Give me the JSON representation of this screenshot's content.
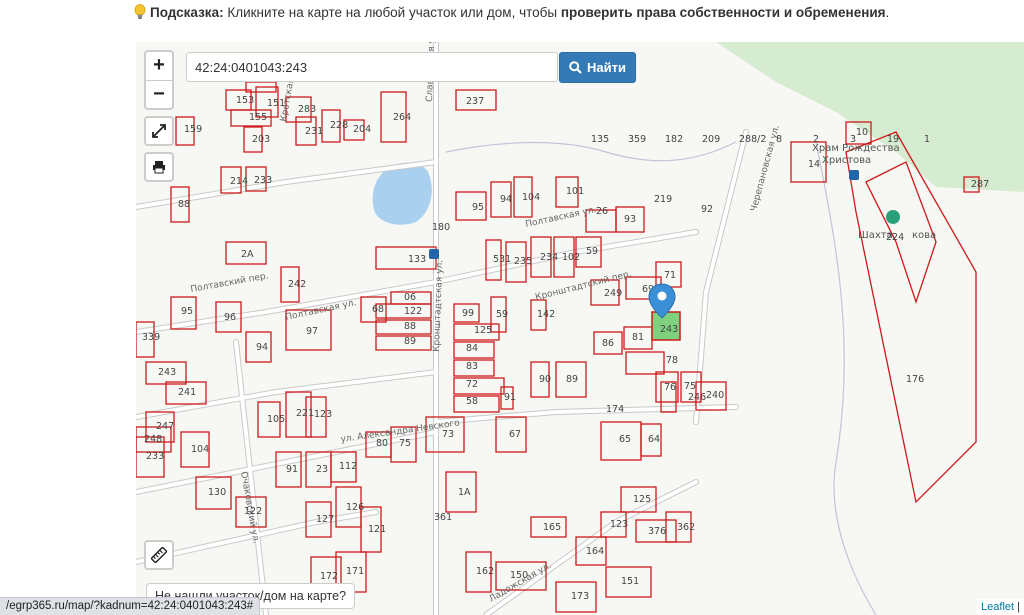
{
  "hint": {
    "label": "Подсказка:",
    "text": " Кликните на карте на любой участок или дом, чтобы ",
    "bold": "проверить права собственности и обременения",
    "end": "."
  },
  "map": {
    "zoom_in": "+",
    "zoom_out": "−",
    "search": {
      "value": "42:24:0401043:243"
    },
    "find_button": "Найти",
    "not_found": "Не нашли участок/дом на карте?",
    "attribution": "Leaflet",
    "attribution_sep": " |",
    "colors": {
      "parcel": "#cc1a1a",
      "selected": "#7fd17f",
      "pin": "#3a8fd6",
      "button": "#337ab7",
      "forest": "#d6ecd0",
      "water": "#a9d0ef"
    },
    "streets": [
      "Полтавский пер.",
      "Полтавская ул.",
      "Полтавская ул.",
      "Кронштадтский пер.",
      "Кронштадтская ул.",
      "ул. Александра Невского",
      "Очаковский ул.",
      "Черепановская ул.",
      "Ладожская ул.",
      "Славянская ул.",
      "Кротская ул."
    ],
    "pois": [
      "Храм Рождества",
      "Христова",
      "Шахта",
      "кова"
    ],
    "parcels": [
      "153",
      "151",
      "155",
      "203",
      "283",
      "231",
      "228",
      "204",
      "264",
      "237",
      "159",
      "10",
      "14",
      "287",
      "224",
      "214",
      "233",
      "88",
      "95",
      "94",
      "104",
      "101",
      "26",
      "92",
      "93",
      "2А",
      "133",
      "531",
      "235",
      "234",
      "102",
      "59",
      "71",
      "69",
      "249",
      "242",
      "68",
      "06",
      "122",
      "88",
      "89",
      "96",
      "95",
      "94",
      "97",
      "339",
      "99",
      "125",
      "59",
      "142",
      "84",
      "83",
      "72",
      "58",
      "91",
      "90",
      "89",
      "86",
      "81",
      "78",
      "76",
      "75",
      "246",
      "240",
      "243",
      "241",
      "247",
      "248",
      "80",
      "233",
      "104",
      "105",
      "221",
      "123",
      "75",
      "73",
      "67",
      "65",
      "64",
      "91",
      "23",
      "112",
      "130",
      "122",
      "1А",
      "127",
      "126",
      "121",
      "125",
      "123",
      "376",
      "362",
      "165",
      "164",
      "162",
      "150",
      "151",
      "173",
      "171",
      "172",
      "176",
      "174",
      "219",
      "180",
      "361",
      "135",
      "359",
      "182",
      "209",
      "288/2",
      "8",
      "2",
      "3",
      "19",
      "1"
    ],
    "selected_parcel": "243"
  },
  "status_url": "/egrp365.ru/map/?kadnum=42:24:0401043:243#"
}
